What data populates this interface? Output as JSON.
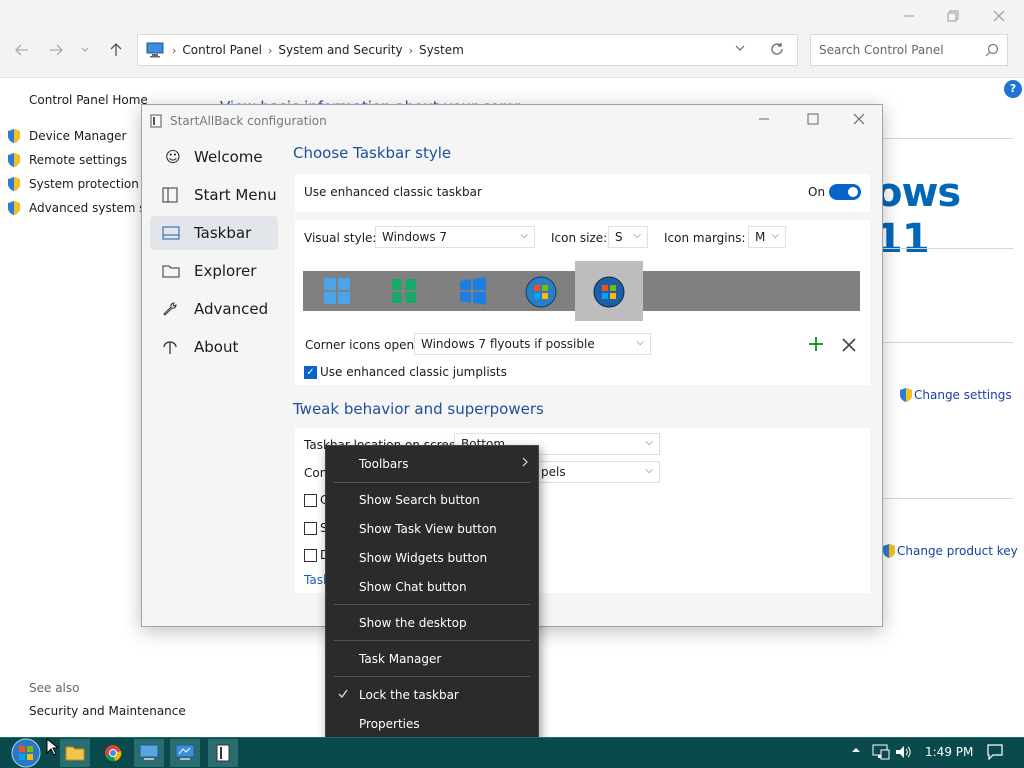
{
  "control_panel": {
    "breadcrumb": [
      "Control Panel",
      "System and Security",
      "System"
    ],
    "search_placeholder": "Search Control Panel",
    "sidebar_home": "Control Panel Home",
    "sidebar_links": [
      "Device Manager",
      "Remote settings",
      "System protection",
      "Advanced system settings"
    ],
    "see_also_label": "See also",
    "see_also_link": "Security and Maintenance",
    "header_partial": "View basic information about your computer",
    "brand_text": "ows 11",
    "change_settings": "Change settings",
    "change_product_key": "Change product key",
    "help_glyph": "?"
  },
  "sab": {
    "title": "StartAllBack configuration",
    "nav": [
      {
        "label": "Welcome",
        "icon": "smiley-icon"
      },
      {
        "label": "Start Menu",
        "icon": "start-menu-icon"
      },
      {
        "label": "Taskbar",
        "icon": "taskbar-icon"
      },
      {
        "label": "Explorer",
        "icon": "folder-icon"
      },
      {
        "label": "Advanced",
        "icon": "wrench-icon"
      },
      {
        "label": "About",
        "icon": "about-icon"
      }
    ],
    "section1_title": "Choose Taskbar style",
    "enhanced_label": "Use enhanced classic taskbar",
    "enhanced_state": "On",
    "visual_style_label": "Visual style:",
    "visual_style_value": "Windows 7",
    "icon_size_label": "Icon size:",
    "icon_size_value": "S",
    "icon_margins_label": "Icon margins:",
    "icon_margins_value": "M",
    "corner_label": "Corner icons open:",
    "corner_value": "Windows 7 flyouts if possible",
    "jumplists_label": "Use enhanced classic jumplists",
    "section2_title": "Tweak behavior and superpowers",
    "location_label": "Taskbar location on screen:",
    "location_value": "Bottom",
    "combine_label": "Con",
    "combine_value": "pels",
    "check_a": "C",
    "check_b": "S",
    "check_c": "D",
    "task_link": "Task"
  },
  "context_menu": {
    "items": [
      "Toolbars",
      "Show Search button",
      "Show Task View button",
      "Show Widgets button",
      "Show Chat button",
      "Show the desktop",
      "Task Manager",
      "Lock the taskbar",
      "Properties"
    ]
  },
  "taskbar": {
    "clock": "1:49 PM"
  },
  "colors": {
    "accent": "#0a63c9",
    "taskbar": "#0b4a4c",
    "menu_bg": "#2b2b2b",
    "title_blue": "#1f4f9c"
  }
}
